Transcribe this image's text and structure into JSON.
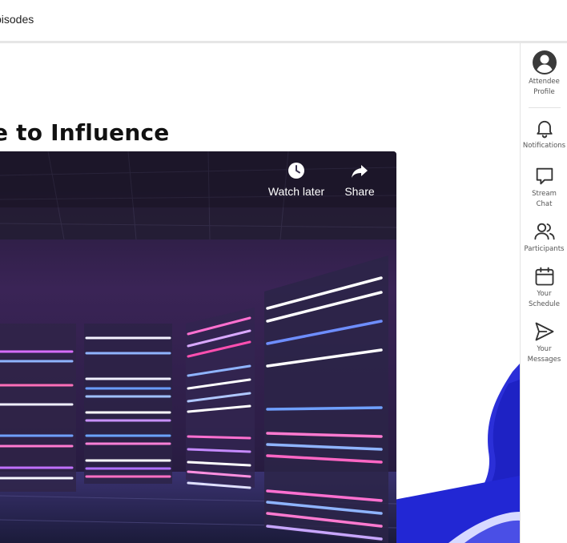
{
  "header": {
    "breadcrumb": "pisodes"
  },
  "page": {
    "title": "e to Influence"
  },
  "video": {
    "watch_later_label": "Watch later",
    "share_label": "Share"
  },
  "sidebar": {
    "items": [
      {
        "icon": "user-circle-icon",
        "label_line1": "Attendee",
        "label_line2": "Profile"
      },
      {
        "icon": "bell-icon",
        "label_line1": "Notifications",
        "label_line2": ""
      },
      {
        "icon": "chat-bubble-icon",
        "label_line1": "Stream",
        "label_line2": "Chat"
      },
      {
        "icon": "users-icon",
        "label_line1": "Participants",
        "label_line2": ""
      },
      {
        "icon": "calendar-icon",
        "label_line1": "Your",
        "label_line2": "Schedule"
      },
      {
        "icon": "send-icon",
        "label_line1": "Your",
        "label_line2": "Messages"
      }
    ]
  },
  "colors": {
    "accent_ribbon": "#2a2fd6",
    "video_bg": "#2a1a3d",
    "sidebar_text": "#555555"
  }
}
